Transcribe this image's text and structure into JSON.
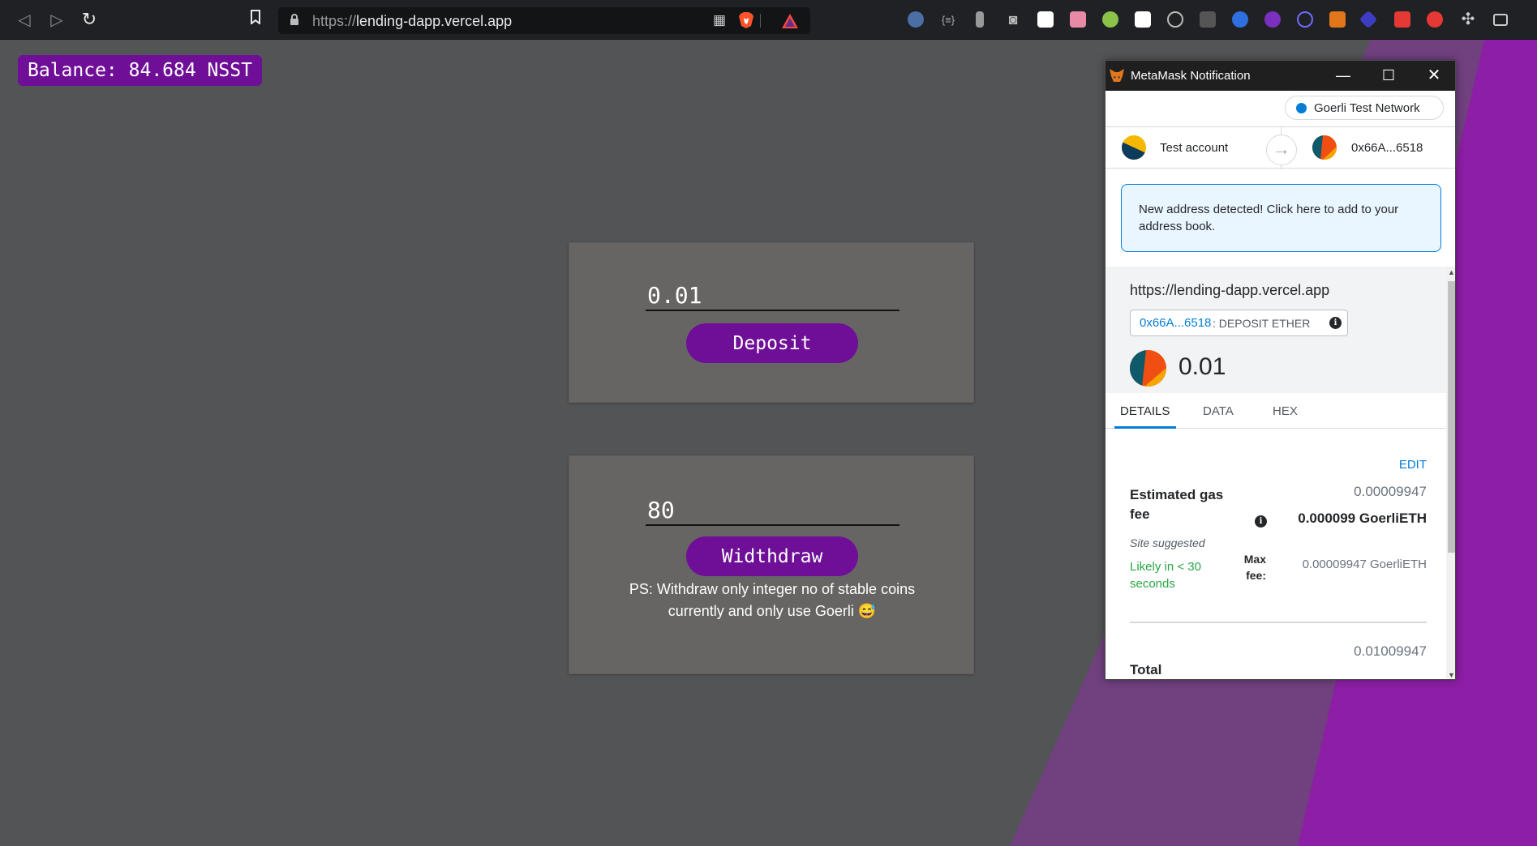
{
  "browser": {
    "url_scheme": "https://",
    "url_host": "lending-dapp.vercel.app"
  },
  "app": {
    "balance_text": "Balance: 84.684 NSST",
    "deposit": {
      "input_value": "0.01",
      "button_label": "Deposit"
    },
    "withdraw": {
      "input_value": "80",
      "button_label": "Widthdraw",
      "note": "PS: Withdraw only integer no of stable coins currently and only use Goerli 😅"
    }
  },
  "metamask": {
    "window_title": "MetaMask Notification",
    "network": "Goerli Test Network",
    "from_account": "Test account",
    "to_account": "0x66A...6518",
    "alert": "New address detected! Click here to add to your address book.",
    "origin": "https://lending-dapp.vercel.app",
    "method_address": "0x66A...6518",
    "method_name": ": DEPOSIT ETHER",
    "amount": "0.01",
    "tabs": [
      "DETAILS",
      "DATA",
      "HEX"
    ],
    "edit_label": "EDIT",
    "gas_title": "Estimated gas fee",
    "gas_value_secondary": "0.00009947",
    "gas_value_primary": "0.000099 GoerliETH",
    "site_suggested": "Site suggested",
    "likely_time": "Likely in < 30 seconds",
    "max_fee_label": "Max fee:",
    "max_fee_value": "0.00009947 GoerliETH",
    "total_value": "0.01009947",
    "total_label": "Total"
  },
  "colors": {
    "brand_purple": "#6f0f97",
    "metamask_blue": "#037dd6",
    "success_green": "#28a745"
  }
}
